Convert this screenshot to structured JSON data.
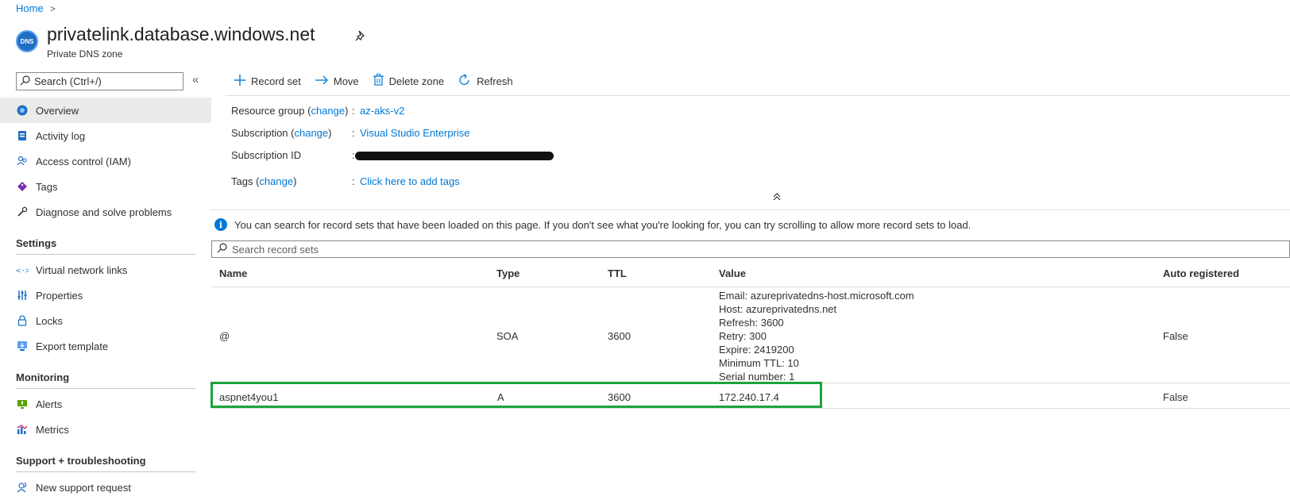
{
  "breadcrumb": {
    "home": "Home",
    "sep": ">"
  },
  "header": {
    "badge": "DNS",
    "title": "privatelink.database.windows.net",
    "subtitle": "Private DNS zone"
  },
  "sidebar": {
    "search_placeholder": "Search (Ctrl+/)",
    "collapse": "«",
    "items": [
      {
        "label": "Overview",
        "icon": "dns-overview-icon"
      },
      {
        "label": "Activity log",
        "icon": "activity-log-icon"
      },
      {
        "label": "Access control (IAM)",
        "icon": "people-icon"
      },
      {
        "label": "Tags",
        "icon": "tag-icon"
      },
      {
        "label": "Diagnose and solve problems",
        "icon": "wrench-icon"
      }
    ],
    "sections": [
      {
        "title": "Settings",
        "items": [
          {
            "label": "Virtual network links",
            "icon": "link-icon"
          },
          {
            "label": "Properties",
            "icon": "sliders-icon"
          },
          {
            "label": "Locks",
            "icon": "lock-icon"
          },
          {
            "label": "Export template",
            "icon": "export-icon"
          }
        ]
      },
      {
        "title": "Monitoring",
        "items": [
          {
            "label": "Alerts",
            "icon": "alert-icon"
          },
          {
            "label": "Metrics",
            "icon": "metrics-icon"
          }
        ]
      },
      {
        "title": "Support + troubleshooting",
        "items": [
          {
            "label": "New support request",
            "icon": "support-icon"
          }
        ]
      }
    ]
  },
  "toolbar": {
    "record_set": "Record set",
    "move": "Move",
    "delete_zone": "Delete zone",
    "refresh": "Refresh"
  },
  "essentials": {
    "resource_group_label": "Resource group (",
    "resource_group_change": "change",
    "resource_group_close": ")",
    "resource_group_value": "az-aks-v2",
    "subscription_label": "Subscription (",
    "subscription_change": "change",
    "subscription_close": ")",
    "subscription_value": "Visual Studio Enterprise",
    "subscription_id_label": "Subscription ID",
    "tags_label": "Tags (",
    "tags_change": "change",
    "tags_close": ")",
    "tags_value": "Click here to add tags",
    "colon": ":"
  },
  "info_text": "You can search for record sets that have been loaded on this page. If you don't see what you're looking for, you can try scrolling to allow more record sets to load.",
  "record_search_placeholder": "Search record sets",
  "table": {
    "headers": [
      "Name",
      "Type",
      "TTL",
      "Value",
      "Auto registered"
    ],
    "rows": [
      {
        "name": "@",
        "type": "SOA",
        "ttl": "3600",
        "value": [
          "Email: azureprivatedns-host.microsoft.com",
          "Host: azureprivatedns.net",
          "Refresh: 3600",
          "Retry: 300",
          "Expire: 2419200",
          "Minimum TTL: 10",
          "Serial number: 1"
        ],
        "auto": "False"
      },
      {
        "name": "aspnet4you1",
        "type": "A",
        "ttl": "3600",
        "value": [
          "172.240.17.4"
        ],
        "auto": "False"
      }
    ]
  },
  "colors": {
    "accent": "#0078d4",
    "highlight": "#1ca33c",
    "active_bg": "#edebe9"
  }
}
